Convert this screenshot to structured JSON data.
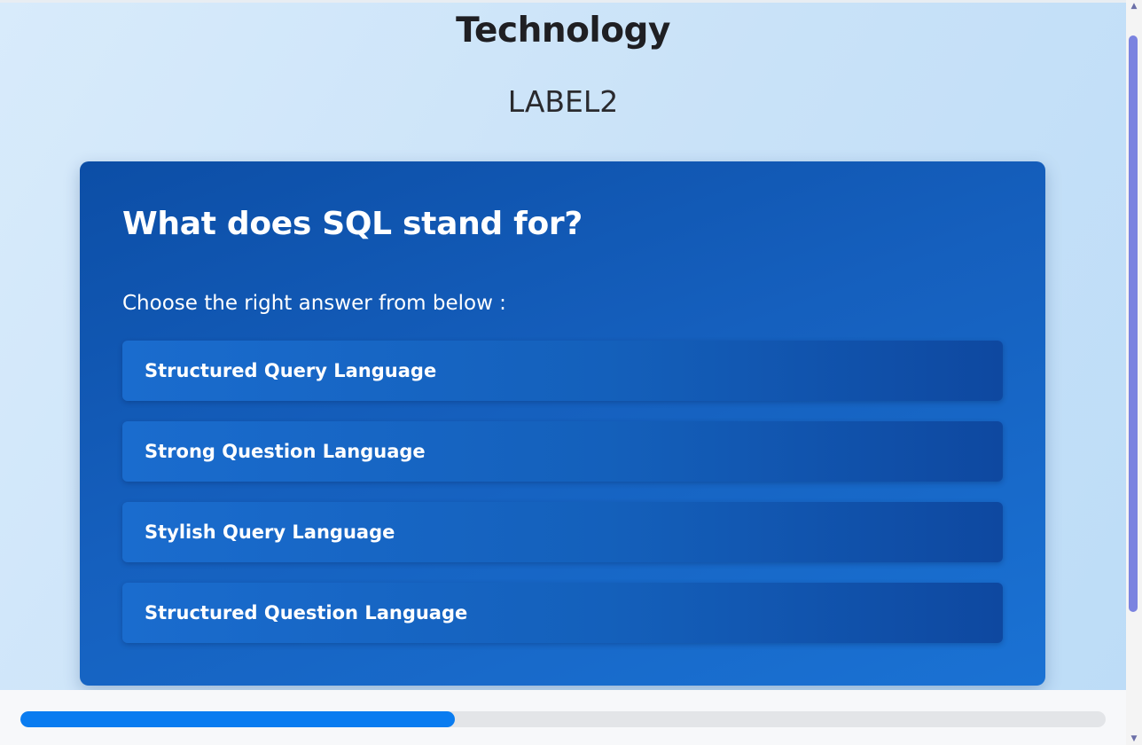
{
  "header": {
    "category": "Technology",
    "label": "LABEL2"
  },
  "quiz": {
    "question": "What does SQL stand for?",
    "instruction": "Choose the right answer from below :",
    "options": [
      "Structured Query Language",
      "Strong Question Language",
      "Stylish Query Language",
      "Structured Question Language"
    ]
  },
  "progress": {
    "percent": 40
  },
  "colors": {
    "card": "#155fbd",
    "progress_fill": "#0a7cf0",
    "scroll_thumb": "#7b83e0"
  }
}
